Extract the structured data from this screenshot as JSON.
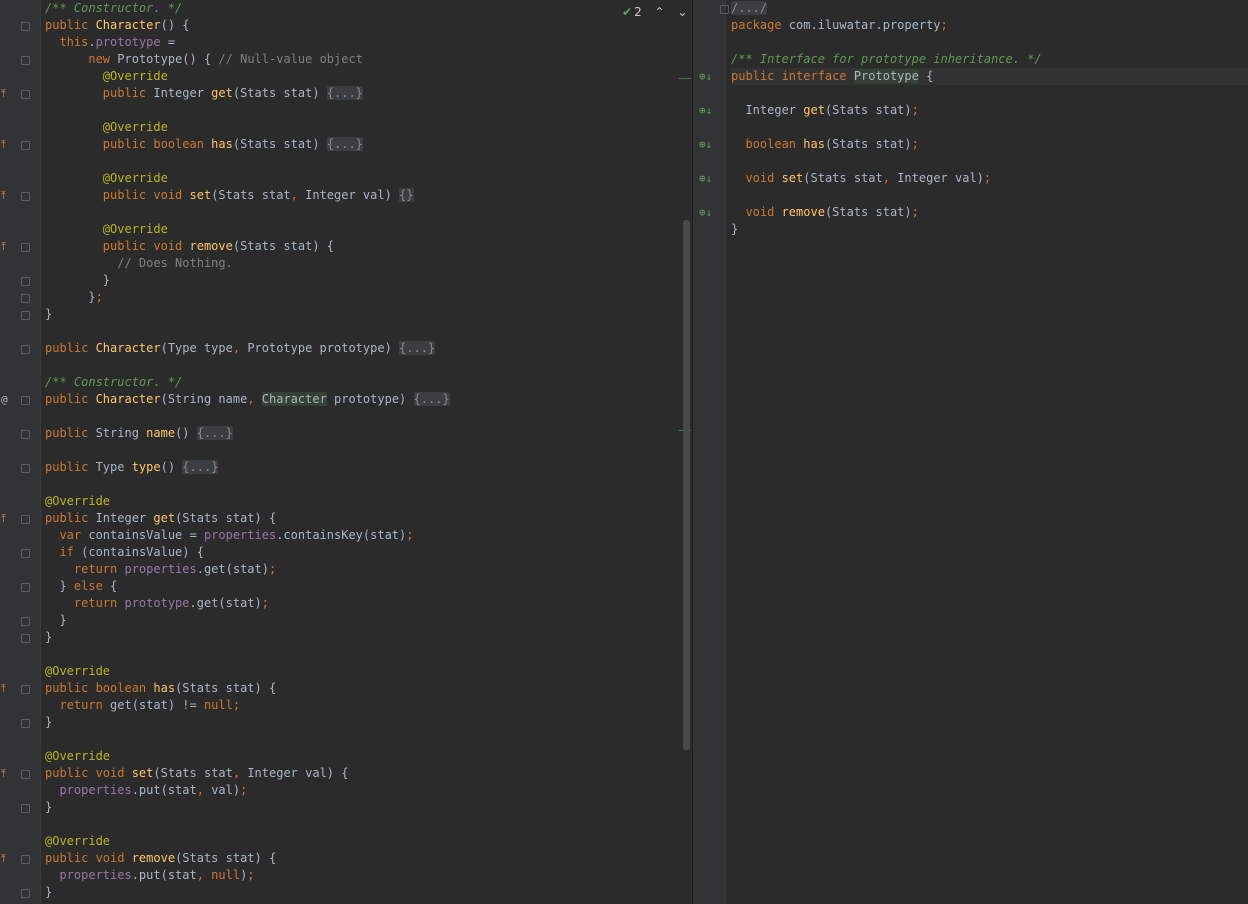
{
  "colors": {
    "keyword": "#cc7832",
    "method": "#ffc66d",
    "annotation": "#bbb529",
    "comment": "#808080",
    "doc": "#629755",
    "field": "#9876aa",
    "plain": "#a9b7c6",
    "folded": "#8a8a8a"
  },
  "inspection": {
    "count": "2",
    "check_icon": "check-icon",
    "up_icon": "chevron-up-icon",
    "down_icon": "chevron-down-icon"
  },
  "left_editor": {
    "lines": [
      [
        [
          "doc",
          "/** Constructor. */"
        ]
      ],
      [
        [
          "kw",
          "public "
        ],
        [
          "m",
          "Character"
        ],
        [
          "p",
          "() {"
        ]
      ],
      [
        [
          "p",
          "  "
        ],
        [
          "kw",
          "this"
        ],
        [
          "p",
          "."
        ],
        [
          "f",
          "prototype"
        ],
        [
          "p",
          " ="
        ]
      ],
      [
        [
          "p",
          "      "
        ],
        [
          "kw",
          "new "
        ],
        [
          "p",
          "Prototype() { "
        ],
        [
          "c",
          "// Null-value object"
        ]
      ],
      [
        [
          "p",
          "        "
        ],
        [
          "a",
          "@Override"
        ]
      ],
      [
        [
          "p",
          "        "
        ],
        [
          "kw",
          "public "
        ],
        [
          "p",
          "Integer "
        ],
        [
          "m",
          "get"
        ],
        [
          "p",
          "(Stats stat) "
        ],
        [
          "fold",
          "{...}"
        ]
      ],
      [
        [
          "p",
          ""
        ]
      ],
      [
        [
          "p",
          "        "
        ],
        [
          "a",
          "@Override"
        ]
      ],
      [
        [
          "p",
          "        "
        ],
        [
          "kw",
          "public boolean "
        ],
        [
          "m",
          "has"
        ],
        [
          "p",
          "(Stats stat) "
        ],
        [
          "fold",
          "{...}"
        ]
      ],
      [
        [
          "p",
          ""
        ]
      ],
      [
        [
          "p",
          "        "
        ],
        [
          "a",
          "@Override"
        ]
      ],
      [
        [
          "p",
          "        "
        ],
        [
          "kw",
          "public void "
        ],
        [
          "m",
          "set"
        ],
        [
          "p",
          "(Stats stat"
        ],
        [
          "kw",
          ", "
        ],
        [
          "p",
          "Integer val) "
        ],
        [
          "fold",
          "{}"
        ]
      ],
      [
        [
          "p",
          ""
        ]
      ],
      [
        [
          "p",
          "        "
        ],
        [
          "a",
          "@Override"
        ]
      ],
      [
        [
          "p",
          "        "
        ],
        [
          "kw",
          "public void "
        ],
        [
          "m",
          "remove"
        ],
        [
          "p",
          "(Stats stat) {"
        ]
      ],
      [
        [
          "p",
          "          "
        ],
        [
          "c",
          "// Does Nothing."
        ]
      ],
      [
        [
          "p",
          "        }"
        ]
      ],
      [
        [
          "p",
          "      }"
        ],
        [
          "kw",
          ";"
        ]
      ],
      [
        [
          "p",
          "}"
        ]
      ],
      [
        [
          "p",
          ""
        ]
      ],
      [
        [
          "kw",
          "public "
        ],
        [
          "m",
          "Character"
        ],
        [
          "p",
          "(Type type"
        ],
        [
          "kw",
          ", "
        ],
        [
          "p",
          "Prototype prototype) "
        ],
        [
          "fold",
          "{...}"
        ]
      ],
      [
        [
          "p",
          ""
        ]
      ],
      [
        [
          "doc",
          "/** Constructor. */"
        ]
      ],
      [
        [
          "kw",
          "public "
        ],
        [
          "m",
          "Character"
        ],
        [
          "p",
          "(String name"
        ],
        [
          "kw",
          ", "
        ],
        [
          "hl",
          "Character"
        ],
        [
          "p",
          " prototype) "
        ],
        [
          "fold",
          "{...}"
        ]
      ],
      [
        [
          "p",
          ""
        ]
      ],
      [
        [
          "kw",
          "public "
        ],
        [
          "p",
          "String "
        ],
        [
          "m",
          "name"
        ],
        [
          "p",
          "() "
        ],
        [
          "fold",
          "{...}"
        ]
      ],
      [
        [
          "p",
          ""
        ]
      ],
      [
        [
          "kw",
          "public "
        ],
        [
          "p",
          "Type "
        ],
        [
          "m",
          "type"
        ],
        [
          "p",
          "() "
        ],
        [
          "fold",
          "{...}"
        ]
      ],
      [
        [
          "p",
          ""
        ]
      ],
      [
        [
          "a",
          "@Override"
        ]
      ],
      [
        [
          "kw",
          "public "
        ],
        [
          "p",
          "Integer "
        ],
        [
          "m",
          "get"
        ],
        [
          "p",
          "(Stats stat) {"
        ]
      ],
      [
        [
          "p",
          "  "
        ],
        [
          "kw",
          "var "
        ],
        [
          "p",
          "containsValue = "
        ],
        [
          "f",
          "properties"
        ],
        [
          "p",
          ".containsKey(stat)"
        ],
        [
          "kw",
          ";"
        ]
      ],
      [
        [
          "p",
          "  "
        ],
        [
          "kw",
          "if "
        ],
        [
          "p",
          "(containsValue) {"
        ]
      ],
      [
        [
          "p",
          "    "
        ],
        [
          "kw",
          "return "
        ],
        [
          "f",
          "properties"
        ],
        [
          "p",
          ".get(stat)"
        ],
        [
          "kw",
          ";"
        ]
      ],
      [
        [
          "p",
          "  } "
        ],
        [
          "kw",
          "else "
        ],
        [
          "p",
          "{"
        ]
      ],
      [
        [
          "p",
          "    "
        ],
        [
          "kw",
          "return "
        ],
        [
          "f",
          "prototype"
        ],
        [
          "p",
          ".get(stat)"
        ],
        [
          "kw",
          ";"
        ]
      ],
      [
        [
          "p",
          "  }"
        ]
      ],
      [
        [
          "p",
          "}"
        ]
      ],
      [
        [
          "p",
          ""
        ]
      ],
      [
        [
          "a",
          "@Override"
        ]
      ],
      [
        [
          "kw",
          "public boolean "
        ],
        [
          "m",
          "has"
        ],
        [
          "p",
          "(Stats stat) {"
        ]
      ],
      [
        [
          "p",
          "  "
        ],
        [
          "kw",
          "return "
        ],
        [
          "p",
          "get(stat) != "
        ],
        [
          "kw",
          "null;"
        ]
      ],
      [
        [
          "p",
          "}"
        ]
      ],
      [
        [
          "p",
          ""
        ]
      ],
      [
        [
          "a",
          "@Override"
        ]
      ],
      [
        [
          "kw",
          "public void "
        ],
        [
          "m",
          "set"
        ],
        [
          "p",
          "(Stats stat"
        ],
        [
          "kw",
          ", "
        ],
        [
          "p",
          "Integer val) {"
        ]
      ],
      [
        [
          "p",
          "  "
        ],
        [
          "f",
          "properties"
        ],
        [
          "p",
          ".put(stat"
        ],
        [
          "kw",
          ", "
        ],
        [
          "p",
          "val)"
        ],
        [
          "kw",
          ";"
        ]
      ],
      [
        [
          "p",
          "}"
        ]
      ],
      [
        [
          "p",
          ""
        ]
      ],
      [
        [
          "a",
          "@Override"
        ]
      ],
      [
        [
          "kw",
          "public void "
        ],
        [
          "m",
          "remove"
        ],
        [
          "p",
          "(Stats stat) {"
        ]
      ],
      [
        [
          "p",
          "  "
        ],
        [
          "f",
          "properties"
        ],
        [
          "p",
          ".put(stat"
        ],
        [
          "kw",
          ", null"
        ],
        [
          "p",
          ")"
        ],
        [
          "kw",
          ";"
        ]
      ],
      [
        [
          "p",
          "}"
        ]
      ]
    ]
  },
  "right_editor": {
    "lines": [
      [
        [
          "fold",
          "/.../"
        ]
      ],
      [
        [
          "kw",
          "package "
        ],
        [
          "p",
          "com.iluwatar.property"
        ],
        [
          "kw",
          ";"
        ]
      ],
      [
        [
          "p",
          ""
        ]
      ],
      [
        [
          "doc",
          "/** Interface for prototype inheritance. */"
        ]
      ],
      [
        [
          "kw",
          "public interface "
        ],
        [
          "hl",
          "Prototype"
        ],
        [
          "p",
          " {"
        ]
      ],
      [
        [
          "p",
          ""
        ]
      ],
      [
        [
          "p",
          "  Integer "
        ],
        [
          "m",
          "get"
        ],
        [
          "p",
          "(Stats stat)"
        ],
        [
          "kw",
          ";"
        ]
      ],
      [
        [
          "p",
          ""
        ]
      ],
      [
        [
          "p",
          "  "
        ],
        [
          "kw",
          "boolean "
        ],
        [
          "m",
          "has"
        ],
        [
          "p",
          "(Stats stat)"
        ],
        [
          "kw",
          ";"
        ]
      ],
      [
        [
          "p",
          ""
        ]
      ],
      [
        [
          "p",
          "  "
        ],
        [
          "kw",
          "void "
        ],
        [
          "m",
          "set"
        ],
        [
          "p",
          "(Stats stat"
        ],
        [
          "kw",
          ", "
        ],
        [
          "p",
          "Integer val)"
        ],
        [
          "kw",
          ";"
        ]
      ],
      [
        [
          "p",
          ""
        ]
      ],
      [
        [
          "p",
          "  "
        ],
        [
          "kw",
          "void "
        ],
        [
          "m",
          "remove"
        ],
        [
          "p",
          "(Stats stat)"
        ],
        [
          "kw",
          ";"
        ]
      ],
      [
        [
          "p",
          "}"
        ]
      ]
    ]
  },
  "gutter_icons": {
    "override_icon": "override-icon",
    "implemented_icon": "implemented-icon",
    "at_sign": "@"
  }
}
